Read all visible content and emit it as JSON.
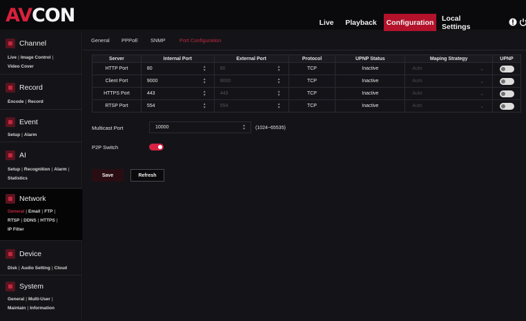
{
  "brand": {
    "logo_left": "AV",
    "logo_right": "CON"
  },
  "nav": {
    "live": "Live",
    "playback": "Playback",
    "configuration": "Configuration",
    "local_settings": "Local Settings"
  },
  "sidebar": {
    "channel": {
      "title": "Channel",
      "links": [
        "Live",
        "Image Control",
        "Video Cover"
      ]
    },
    "record": {
      "title": "Record",
      "links": [
        "Encode",
        "Record"
      ]
    },
    "event": {
      "title": "Event",
      "links": [
        "Setup",
        "Alarm"
      ]
    },
    "ai": {
      "title": "AI",
      "links": [
        "Setup",
        "Recognition",
        "Alarm",
        "Statistics"
      ]
    },
    "network": {
      "title": "Network",
      "links": [
        "General",
        "Email",
        "FTP",
        "RTSP",
        "DDNS",
        "HTTPS",
        "IP Filter"
      ]
    },
    "device": {
      "title": "Device",
      "links": [
        "Disk",
        "Audio Setting",
        "Cloud"
      ]
    },
    "system": {
      "title": "System",
      "links": [
        "General",
        "Multi-User",
        "Maintain",
        "Information"
      ]
    }
  },
  "tabs": [
    "General",
    "PPPoE",
    "SNMP",
    "Port Configuration"
  ],
  "table": {
    "headers": [
      "Server",
      "Internal Port",
      "External Port",
      "Protocol",
      "UPNP Status",
      "Maping Strategy",
      "UPNP"
    ],
    "rows": [
      {
        "server": "HTTP Port",
        "internal": "80",
        "external": "80",
        "protocol": "TCP",
        "status": "Inactive",
        "strategy": "Auto",
        "upnp": false
      },
      {
        "server": "Client Port",
        "internal": "9000",
        "external": "9000",
        "protocol": "TCP",
        "status": "Inactive",
        "strategy": "Auto",
        "upnp": false
      },
      {
        "server": "HTTPS Port",
        "internal": "443",
        "external": "443",
        "protocol": "TCP",
        "status": "Inactive",
        "strategy": "Auto",
        "upnp": false
      },
      {
        "server": "RTSP Port",
        "internal": "554",
        "external": "554",
        "protocol": "TCP",
        "status": "Inactive",
        "strategy": "Auto",
        "upnp": false
      }
    ]
  },
  "multicast": {
    "label": "Multicast Port",
    "value": "10000",
    "range": "(1024~65535)"
  },
  "p2p": {
    "label": "P2P Switch",
    "enabled": true
  },
  "buttons": {
    "save": "Save",
    "refresh": "Refresh"
  },
  "colors": {
    "accent": "#b3122a",
    "toggle_on": "#d62344"
  }
}
